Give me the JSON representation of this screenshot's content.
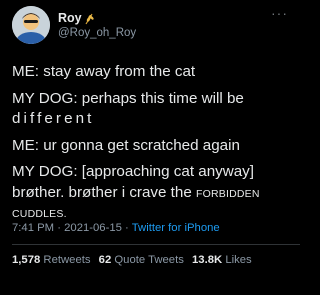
{
  "author": {
    "display_name": "Roy",
    "handle": "@Roy_oh_Roy",
    "avatar_icon": "person-avatar-icon",
    "name_emoji_icon": "wheat-emoji-icon"
  },
  "menu_icon": "more-options-icon",
  "tweet": {
    "lines": [
      "ME: stay away from the cat",
      "MY DOG: perhaps this time will be",
      "different",
      "ME: ur gonna get scratched again",
      "MY DOG: [approaching cat anyway]",
      "brøther. brøther i crave the ",
      "FORBIDDEN",
      "CUDDLES."
    ]
  },
  "meta": {
    "time": "7:41 PM",
    "sep": " · ",
    "date": "2021-06-15",
    "sep2": " · ",
    "source": "Twitter for iPhone"
  },
  "stats": {
    "retweets_count": "1,578",
    "retweets_label": "Retweets",
    "quotes_count": "62",
    "quotes_label": "Quote Tweets",
    "likes_count": "13.8K",
    "likes_label": "Likes"
  },
  "colors": {
    "background": "#000000",
    "text": "#e7e9ea",
    "secondary": "#8b98a5",
    "link": "#1d9bf0"
  }
}
